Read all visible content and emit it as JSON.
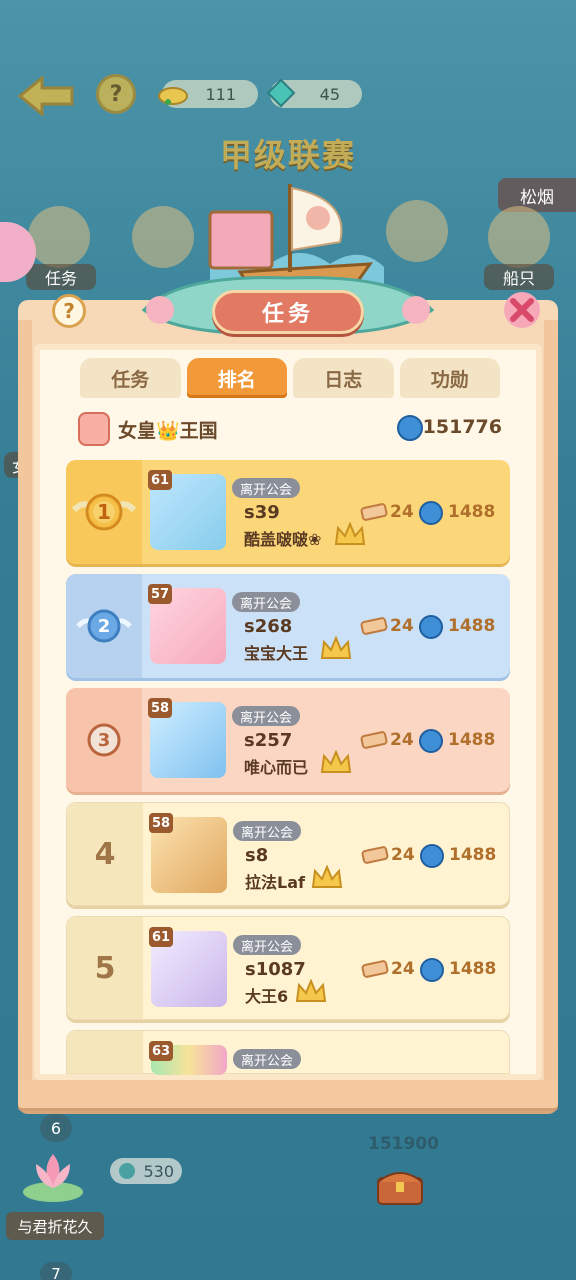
{
  "top": {
    "resource1": "111",
    "resource2": "45",
    "league_title": "甲级联赛",
    "right_tag": "松烟"
  },
  "side": {
    "task_label": "任务",
    "ship_label": "船只",
    "left_peek": "女"
  },
  "panel": {
    "title": "任务",
    "help": "?",
    "tabs": [
      {
        "label": "任务",
        "active": false
      },
      {
        "label": "排名",
        "active": true
      },
      {
        "label": "日志",
        "active": false
      },
      {
        "label": "功勋",
        "active": false
      }
    ],
    "kingdom": {
      "name": "女皇👑王国",
      "score": "151776"
    }
  },
  "rankings": [
    {
      "rank": "1",
      "level": "61",
      "guild": "离开公会",
      "server": "s39",
      "name": "酷盖啵啵❀",
      "scrolls": "24",
      "points": "1488"
    },
    {
      "rank": "2",
      "level": "57",
      "guild": "离开公会",
      "server": "s268",
      "name": "宝宝大王",
      "scrolls": "24",
      "points": "1488"
    },
    {
      "rank": "3",
      "level": "58",
      "guild": "离开公会",
      "server": "s257",
      "name": "唯心而已",
      "scrolls": "24",
      "points": "1488"
    },
    {
      "rank": "4",
      "level": "58",
      "guild": "离开公会",
      "server": "s8",
      "name": "拉法Laf",
      "scrolls": "24",
      "points": "1488"
    },
    {
      "rank": "5",
      "level": "61",
      "guild": "离开公会",
      "server": "s1087",
      "name": "大王6",
      "scrolls": "24",
      "points": "1488"
    },
    {
      "rank": "",
      "level": "63",
      "guild": "离开公会"
    }
  ],
  "bottom": {
    "rank6": "6",
    "team_name": "与君折花久",
    "team_score": "530",
    "total": "151900",
    "rank7": "7"
  },
  "colors": {
    "tab_active": "#f29a39",
    "title_plaque": "#e27a63",
    "gold_row": "#fbd77a",
    "silver_row": "#cbe1f7",
    "bronze_row": "#fbd7c3"
  },
  "icons": [
    "back-arrow-icon",
    "help-icon",
    "gold-icon",
    "gem-icon",
    "ship-icon",
    "close-icon",
    "compass-icon",
    "scroll-icon",
    "crown-icon",
    "medal-icon",
    "chest-icon",
    "lotus-icon"
  ]
}
